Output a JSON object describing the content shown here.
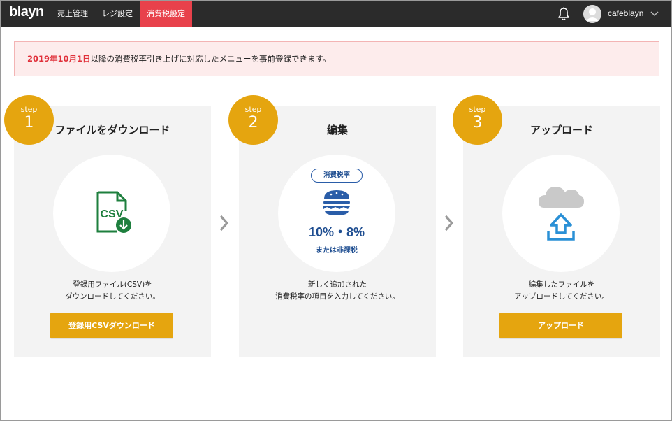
{
  "header": {
    "logo": "blayn",
    "nav": [
      {
        "label": "売上管理"
      },
      {
        "label": "レジ設定"
      },
      {
        "label": "消費税設定",
        "active": true
      }
    ],
    "icons": {
      "bell": "bell-icon",
      "avatar": "user-avatar-icon",
      "caret": "chevron-down-icon"
    },
    "username": "cafeblayn"
  },
  "notice": {
    "date": "2019年10月1日",
    "text": "以降の消費税率引き上げに対応したメニューを事前登録できます。"
  },
  "steps": [
    {
      "step_word": "step",
      "number": "1",
      "title": "ファイルをダウンロード",
      "icon": "csv-download-icon",
      "icon_text": "CSV",
      "desc_line1": "登録用ファイル(CSV)を",
      "desc_line2": "ダウンロードしてください。",
      "button": "登録用CSVダウンロード"
    },
    {
      "step_word": "step",
      "number": "2",
      "title": "編集",
      "icon": "burger-icon",
      "pill": "消費税率",
      "rate": "10%・8%",
      "rate_sub": "または非課税",
      "desc_line1": "新しく追加された",
      "desc_line2": "消費税率の項目を入力してください。"
    },
    {
      "step_word": "step",
      "number": "3",
      "title": "アップロード",
      "icon": "cloud-upload-icon",
      "desc_line1": "編集したファイルを",
      "desc_line2": "アップロードしてください。",
      "button": "アップロード"
    }
  ],
  "colors": {
    "topbar": "#2b2b2b",
    "active_nav": "#e8414b",
    "accent": "#e5a50f",
    "notice_bg": "#fdecec",
    "notice_date": "#e0303a",
    "csv_green": "#1e7f3e",
    "tax_blue": "#1f4e91",
    "upload_blue": "#2a90d6"
  }
}
